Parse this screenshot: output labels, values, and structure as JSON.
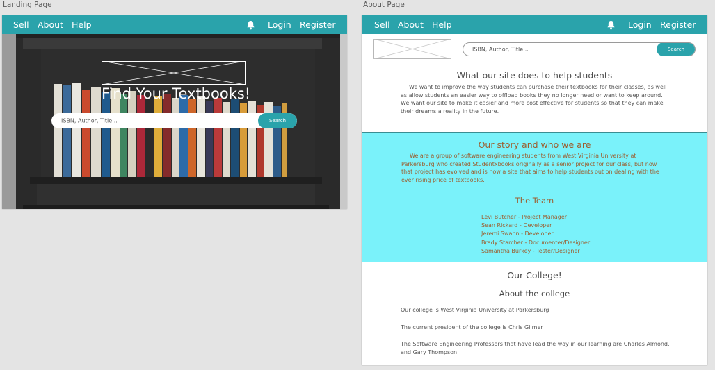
{
  "artboards": {
    "landing_label": "Landing Page",
    "about_label": "About Page"
  },
  "nav": {
    "sell": "Sell",
    "about": "About",
    "help": "Help",
    "login": "Login",
    "register": "Register",
    "bell_icon": "bell-icon"
  },
  "landing": {
    "hero_title": "Find Your Textbooks!",
    "search_placeholder": "ISBN, Author, Title...",
    "search_button": "Search"
  },
  "about": {
    "search_placeholder": "ISBN, Author, Title...",
    "search_button": "Search",
    "site_heading": "What our site does to help students",
    "site_text": "We want to improve the way students can purchase their textbooks for their classes, as well as allow students an easier way to offload books they no longer need or want to keep around. We want our site to make it easier and more cost effective for students so that they can make their dreams a reality in the future.",
    "story_heading": "Our story and who we are",
    "story_text": "We are a group of software engineering students from West Virginia University at Parkersburg who created Studentxbooks originally as a senior project for our class, but now that project has evolved and is now a site that aims to help students out on dealing with the ever rising price of textbooks.",
    "team_heading": "The Team",
    "team": [
      "Levi Butcher - Project Manager",
      "Sean Rickard - Developer",
      "Jeremi Swann - Developer",
      "Brady Starcher - Documenter/Designer",
      "Samantha Burkey - Tester/Designer"
    ],
    "college_heading": "Our College!",
    "about_college_heading": "About the college",
    "college_lines": [
      "Our college is West Virginia University at Parkersburg",
      "The current president of the college is Chris Gilmer",
      "The Software Engineering Professors that have lead the way in our learning are Charles Almond, and Gary Thompson"
    ]
  },
  "colors": {
    "nav": "#2aa3ab",
    "story_bg": "#7af2fa",
    "story_text": "#9c5e2f"
  }
}
